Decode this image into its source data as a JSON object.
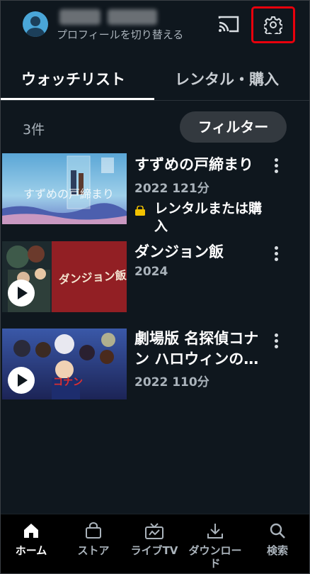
{
  "header": {
    "profile_switch_label": "プロフィールを切り替える"
  },
  "tabs": [
    {
      "label": "ウォッチリスト",
      "active": true
    },
    {
      "label": "レンタル・購入",
      "active": false
    }
  ],
  "list": {
    "count_label": "3件",
    "filter_label": "フィルター",
    "items": [
      {
        "title": "すずめの戸締まり",
        "meta": "2022 121分",
        "badge": "レンタルまたは購入"
      },
      {
        "title": "ダンジョン飯",
        "meta": "2024"
      },
      {
        "title": "劇場版 名探偵コナン ハロウィンの…",
        "meta": "2022 110分"
      }
    ]
  },
  "bottom_nav": [
    {
      "label": "ホーム",
      "icon": "home-icon",
      "active": true
    },
    {
      "label": "ストア",
      "icon": "store-bag-icon",
      "active": false
    },
    {
      "label": "ライブTV",
      "icon": "live-tv-icon",
      "active": false
    },
    {
      "label": "ダウンロード",
      "icon": "download-icon",
      "active": false
    },
    {
      "label": "検索",
      "icon": "search-icon",
      "active": false
    }
  ],
  "colors": {
    "background": "#0f171e",
    "highlight": "#e8000c",
    "rent_badge": "#f2c200"
  }
}
